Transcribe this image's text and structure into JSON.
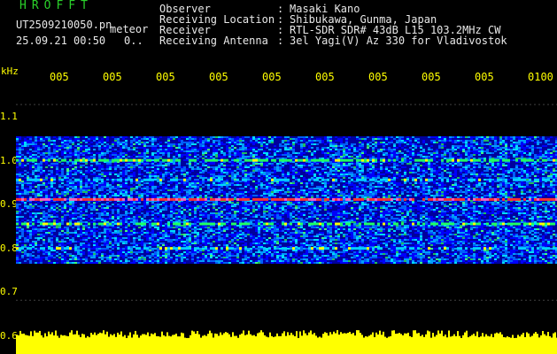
{
  "header": {
    "logo": "HROFFT",
    "filename": "UT2509210050.pn",
    "meteor_label": "meteor",
    "datetime": "25.09.21 00:50",
    "datetime_mark": "0..",
    "info": [
      {
        "key": "Observer",
        "value": "Masaki Kano"
      },
      {
        "key": "Receiving Location",
        "value": "Shibukawa, Gunma, Japan"
      },
      {
        "key": "Receiver",
        "value": "RTL-SDR SDR# 43dB L15 103.2MHz CW"
      },
      {
        "key": "Receiving Antenna",
        "value": "3el Yagi(V) Az 330 for Vladivostok"
      }
    ]
  },
  "spectrogram": {
    "y_unit": "kHz",
    "y_ticks": [
      "1.1",
      "1.0",
      "0.9",
      "0.8",
      "0.7",
      "0.6"
    ],
    "x_ticks": [
      "005",
      "005",
      "005",
      "005",
      "005",
      "005",
      "005",
      "005",
      "005",
      "0100"
    ],
    "colors": {
      "background": "#000000",
      "axis_text": "#ffff00",
      "signal_strong": "#ff3030",
      "band": "#00c8ff",
      "noise_floor": "#0000c0",
      "power_trace": "#ffff00"
    }
  },
  "chart_data": {
    "type": "heatmap",
    "title": "",
    "xlabel": "",
    "ylabel": "kHz",
    "ylim": [
      0.59,
      1.14
    ],
    "x_tick_labels": [
      "005",
      "005",
      "005",
      "005",
      "005",
      "005",
      "005",
      "005",
      "005",
      "0100"
    ],
    "y_tick_labels": [
      "1.1",
      "1.0",
      "0.9",
      "0.8",
      "0.7",
      "0.6"
    ],
    "bands": [
      {
        "from_khz": 0.775,
        "to_khz": 1.035,
        "level": "noise"
      },
      {
        "at_khz": 0.985,
        "level": "strong"
      },
      {
        "at_khz": 0.945,
        "level": "medium"
      },
      {
        "at_khz": 0.905,
        "level": "strongest"
      },
      {
        "at_khz": 0.855,
        "level": "strong"
      },
      {
        "at_khz": 0.805,
        "level": "medium"
      }
    ],
    "power_trace": {
      "color": "#ffff00",
      "position": "bottom"
    }
  }
}
